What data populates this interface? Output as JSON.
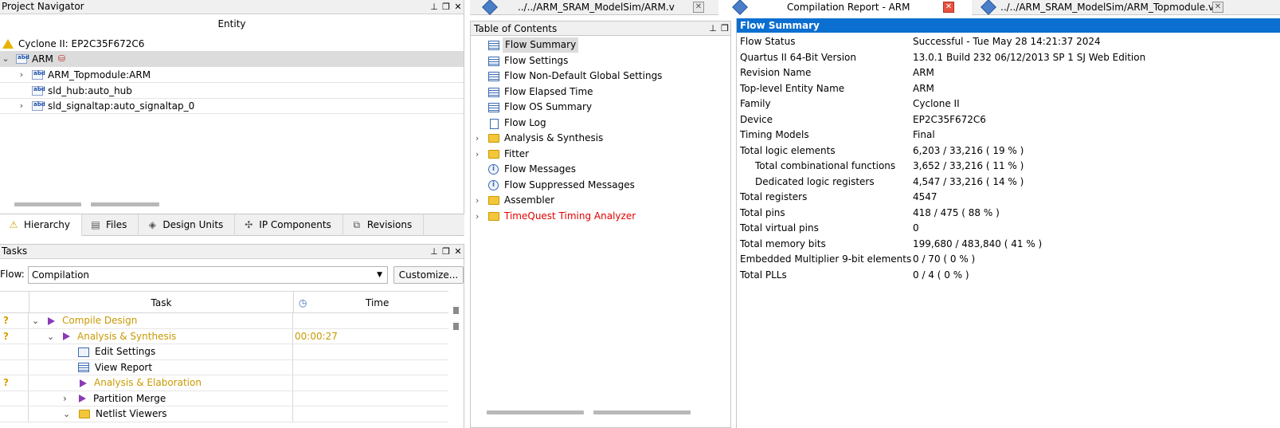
{
  "navigator": {
    "title": "Project Navigator",
    "column": "Entity",
    "device": "Cyclone II: EP2C35F672C6",
    "items": [
      {
        "label": "ARM"
      },
      {
        "label": "ARM_Topmodule:ARM"
      },
      {
        "label": "sld_hub:auto_hub"
      },
      {
        "label": "sld_signaltap:auto_signaltap_0"
      }
    ]
  },
  "tabs": [
    {
      "label": "Hierarchy"
    },
    {
      "label": "Files"
    },
    {
      "label": "Design Units"
    },
    {
      "label": "IP Components"
    },
    {
      "label": "Revisions"
    }
  ],
  "tasks": {
    "title": "Tasks",
    "flow_label": "Flow:",
    "flow_value": "Compilation",
    "customize": "Customize...",
    "col_task": "Task",
    "col_time": "Time",
    "rows": [
      {
        "label": "Compile Design",
        "time": ""
      },
      {
        "label": "Analysis & Synthesis",
        "time": "00:00:27"
      },
      {
        "label": "Edit Settings",
        "time": ""
      },
      {
        "label": "View Report",
        "time": ""
      },
      {
        "label": "Analysis & Elaboration",
        "time": ""
      },
      {
        "label": "Partition Merge",
        "time": ""
      },
      {
        "label": "Netlist Viewers",
        "time": ""
      }
    ]
  },
  "doc_tabs": [
    {
      "label": "../../ARM_SRAM_ModelSim/ARM.v"
    },
    {
      "label": "Compilation Report - ARM"
    },
    {
      "label": "../../ARM_SRAM_ModelSim/ARM_Topmodule.v"
    }
  ],
  "toc": {
    "title": "Table of Contents",
    "items": [
      {
        "label": "Flow Summary"
      },
      {
        "label": "Flow Settings"
      },
      {
        "label": "Flow Non-Default Global Settings"
      },
      {
        "label": "Flow Elapsed Time"
      },
      {
        "label": "Flow OS Summary"
      },
      {
        "label": "Flow Log"
      },
      {
        "label": "Analysis & Synthesis"
      },
      {
        "label": "Fitter"
      },
      {
        "label": "Flow Messages"
      },
      {
        "label": "Flow Suppressed Messages"
      },
      {
        "label": "Assembler"
      },
      {
        "label": "TimeQuest Timing Analyzer"
      }
    ]
  },
  "summary": {
    "title": "Flow Summary",
    "rows": [
      {
        "key": "Flow Status",
        "value": "Successful - Tue May 28 14:21:37 2024"
      },
      {
        "key": "Quartus II 64-Bit Version",
        "value": "13.0.1 Build 232 06/12/2013 SP 1 SJ Web Edition"
      },
      {
        "key": "Revision Name",
        "value": "ARM"
      },
      {
        "key": "Top-level Entity Name",
        "value": "ARM"
      },
      {
        "key": "Family",
        "value": "Cyclone II"
      },
      {
        "key": "Device",
        "value": "EP2C35F672C6"
      },
      {
        "key": "Timing Models",
        "value": "Final"
      },
      {
        "key": "Total logic elements",
        "value": "6,203 / 33,216 ( 19 % )"
      },
      {
        "key": "Total combinational functions",
        "value": "3,652 / 33,216 ( 11 % )"
      },
      {
        "key": "Dedicated logic registers",
        "value": "4,547 / 33,216 ( 14 % )"
      },
      {
        "key": "Total registers",
        "value": "4547"
      },
      {
        "key": "Total pins",
        "value": "418 / 475 ( 88 % )"
      },
      {
        "key": "Total virtual pins",
        "value": "0"
      },
      {
        "key": "Total memory bits",
        "value": "199,680 / 483,840 ( 41 % )"
      },
      {
        "key": "Embedded Multiplier 9-bit elements",
        "value": "0 / 70 ( 0 % )"
      },
      {
        "key": "Total PLLs",
        "value": "0 / 4 ( 0 % )"
      }
    ]
  },
  "colors": {
    "summary_header": "#0a6fd0",
    "task_orange": "#c89a00",
    "timequest_red": "#e00000"
  }
}
